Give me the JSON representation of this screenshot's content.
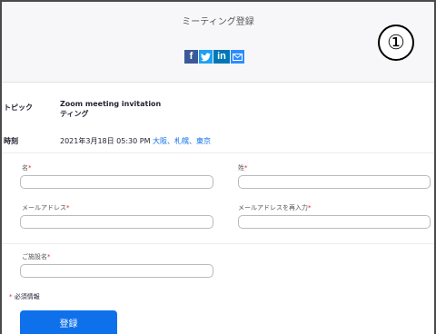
{
  "header": {
    "title": "ミーティング登録",
    "share": {
      "facebook": "f",
      "twitter": "t",
      "linkedin": "in",
      "email": "✉"
    },
    "step_badge": "①"
  },
  "info": {
    "topic_label": "トピック",
    "topic_line1": "Zoom meeting invitation",
    "topic_line2": "ティング",
    "time_label": "時刻",
    "time_value": "2021年3月18日 05:30 PM ",
    "time_zone": "大阪、札幌、東京"
  },
  "form": {
    "required_mark": "*",
    "first_name_label": "名",
    "last_name_label": "姓",
    "email_label": "メールアドレス",
    "email_confirm_label": "メールアドレスを再入力",
    "company_label": "ご施設名",
    "required_note": "必須情報",
    "submit_label": "登録"
  },
  "colors": {
    "accent": "#0e71eb",
    "required": "#e02828",
    "facebook": "#3b5998",
    "twitter": "#1da1f2",
    "linkedin": "#0077b5"
  }
}
